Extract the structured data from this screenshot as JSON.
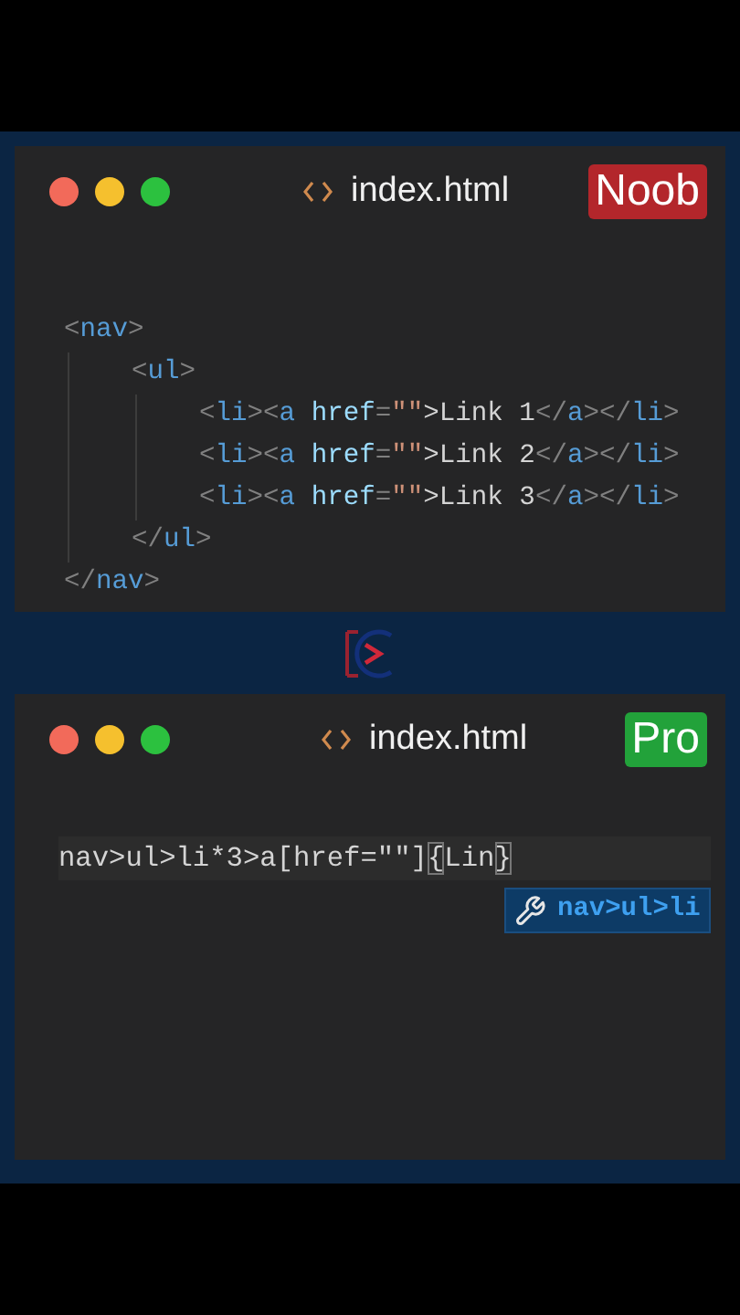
{
  "panels": [
    {
      "title": "index.html",
      "badge": {
        "label": "Noob",
        "color": "#b3262b"
      },
      "kind": "tree",
      "code": [
        {
          "open": [
            {
              "text": "<",
              "kind": "punct"
            },
            {
              "text": "nav",
              "kind": "tag"
            },
            {
              "text": ">",
              "kind": "punct"
            }
          ],
          "close": [
            {
              "text": "</",
              "kind": "punct"
            },
            {
              "text": "nav",
              "kind": "tag"
            },
            {
              "text": ">",
              "kind": "punct"
            }
          ],
          "children": [
            {
              "open": [
                {
                  "text": "<",
                  "kind": "punct"
                },
                {
                  "text": "ul",
                  "kind": "tag"
                },
                {
                  "text": ">",
                  "kind": "punct"
                }
              ],
              "close": [
                {
                  "text": "</",
                  "kind": "punct"
                },
                {
                  "text": "ul",
                  "kind": "tag"
                },
                {
                  "text": ">",
                  "kind": "punct"
                }
              ],
              "children": [
                {
                  "open": [
                    {
                      "text": "<",
                      "kind": "punct"
                    },
                    {
                      "text": "li",
                      "kind": "tag"
                    },
                    {
                      "text": "><",
                      "kind": "punct"
                    },
                    {
                      "text": "a",
                      "kind": "tag"
                    },
                    {
                      "text": " href",
                      "kind": "attr"
                    },
                    {
                      "text": "=",
                      "kind": "punct"
                    },
                    {
                      "text": "\"\"",
                      "kind": "string"
                    },
                    {
                      "text": ">Link 1",
                      "kind": "text"
                    },
                    {
                      "text": "</",
                      "kind": "punct"
                    },
                    {
                      "text": "a",
                      "kind": "tag"
                    },
                    {
                      "text": "></",
                      "kind": "punct"
                    },
                    {
                      "text": "li",
                      "kind": "tag"
                    },
                    {
                      "text": ">",
                      "kind": "punct"
                    }
                  ]
                },
                {
                  "open": [
                    {
                      "text": "<",
                      "kind": "punct"
                    },
                    {
                      "text": "li",
                      "kind": "tag"
                    },
                    {
                      "text": "><",
                      "kind": "punct"
                    },
                    {
                      "text": "a",
                      "kind": "tag"
                    },
                    {
                      "text": " href",
                      "kind": "attr"
                    },
                    {
                      "text": "=",
                      "kind": "punct"
                    },
                    {
                      "text": "\"\"",
                      "kind": "string"
                    },
                    {
                      "text": ">Link 2",
                      "kind": "text"
                    },
                    {
                      "text": "</",
                      "kind": "punct"
                    },
                    {
                      "text": "a",
                      "kind": "tag"
                    },
                    {
                      "text": "></",
                      "kind": "punct"
                    },
                    {
                      "text": "li",
                      "kind": "tag"
                    },
                    {
                      "text": ">",
                      "kind": "punct"
                    }
                  ]
                },
                {
                  "open": [
                    {
                      "text": "<",
                      "kind": "punct"
                    },
                    {
                      "text": "li",
                      "kind": "tag"
                    },
                    {
                      "text": "><",
                      "kind": "punct"
                    },
                    {
                      "text": "a",
                      "kind": "tag"
                    },
                    {
                      "text": " href",
                      "kind": "attr"
                    },
                    {
                      "text": "=",
                      "kind": "punct"
                    },
                    {
                      "text": "\"\"",
                      "kind": "string"
                    },
                    {
                      "text": ">Link 3",
                      "kind": "text"
                    },
                    {
                      "text": "</",
                      "kind": "punct"
                    },
                    {
                      "text": "a",
                      "kind": "tag"
                    },
                    {
                      "text": "></",
                      "kind": "punct"
                    },
                    {
                      "text": "li",
                      "kind": "tag"
                    },
                    {
                      "text": ">",
                      "kind": "punct"
                    }
                  ]
                }
              ]
            }
          ]
        }
      ]
    },
    {
      "title": "index.html",
      "badge": {
        "label": "Pro",
        "color": "#22a23a"
      },
      "kind": "abbreviation",
      "input": {
        "before": "nav>ul>li*3>a[href=\"\"]",
        "open_brace": "{",
        "middle": "Lin",
        "close_brace": "}"
      },
      "suggestion": "nav>ul>li"
    }
  ]
}
